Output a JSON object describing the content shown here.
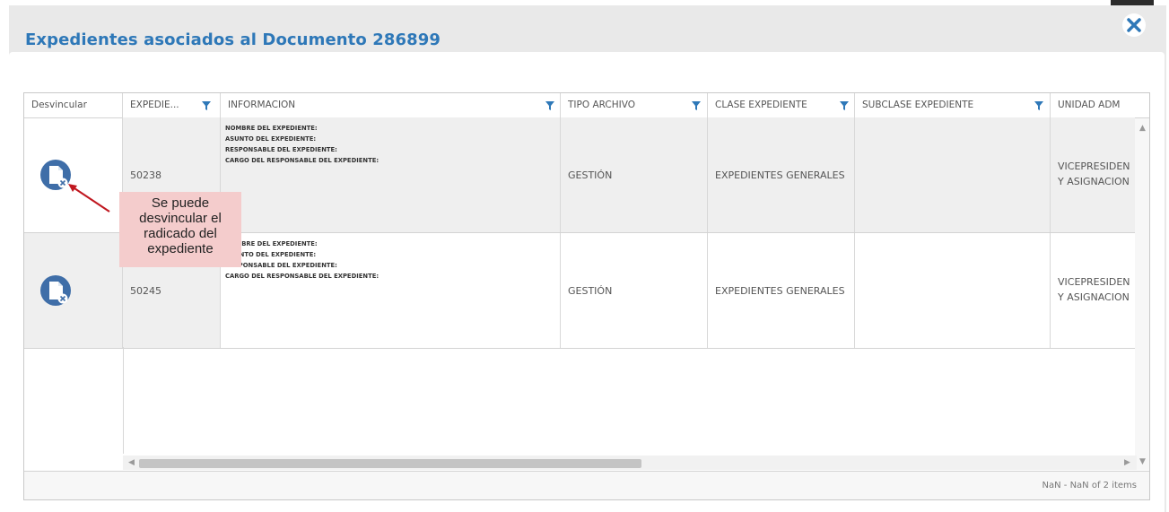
{
  "dialog": {
    "title": "Expedientes asociados al Documento 286899"
  },
  "grid": {
    "columns": [
      {
        "label": "Desvincular",
        "filter": false
      },
      {
        "label": "EXPEDIE...",
        "filter": true
      },
      {
        "label": "INFORMACION",
        "filter": true
      },
      {
        "label": "TIPO ARCHIVO",
        "filter": true
      },
      {
        "label": "CLASE EXPEDIENTE",
        "filter": true
      },
      {
        "label": "SUBCLASE EXPEDIENTE",
        "filter": true
      },
      {
        "label": "UNIDAD ADM",
        "filter": false
      }
    ],
    "info_labels": [
      "NOMBRE DEL EXPEDIENTE:",
      "ASUNTO DEL EXPEDIENTE:",
      "RESPONSABLE DEL EXPEDIENTE:",
      "CARGO DEL RESPONSABLE DEL EXPEDIENTE:"
    ],
    "rows": [
      {
        "expediente": "50238",
        "tipo_archivo": "GESTIÓN",
        "clase": "EXPEDIENTES GENERALES",
        "subclase": "",
        "unidad": "VICEPRESIDEN\nY ASIGNACION"
      },
      {
        "expediente": "50245",
        "tipo_archivo": "GESTIÓN",
        "clase": "EXPEDIENTES GENERALES",
        "subclase": "",
        "unidad": "VICEPRESIDEN\nY ASIGNACION"
      }
    ],
    "pager_info": "NaN - NaN of 2 items"
  },
  "callout": {
    "text": "Se puede desvincular el radicado del expediente"
  },
  "icons": {
    "close": "close-icon",
    "unlink": "unlink-document-icon",
    "filter": "filter-icon"
  },
  "colors": {
    "accent": "#2e78b8",
    "icon": "#3f6ea8",
    "callout_bg": "#f4cccc",
    "arrow": "#c0171f"
  }
}
